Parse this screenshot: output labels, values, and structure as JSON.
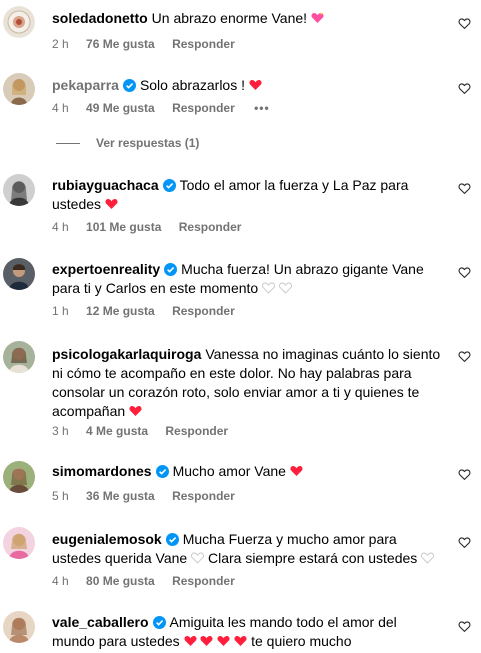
{
  "comments": [
    {
      "username": "soledadonetto",
      "verified": false,
      "muted_name": false,
      "text": "Un abrazo enorme Vane!",
      "emojis": "sparkling-heart",
      "time": "2 h",
      "likes": "76 Me gusta",
      "reply": "Responder",
      "more": ""
    },
    {
      "username": "pekaparra",
      "verified": true,
      "muted_name": true,
      "text": "Solo abrazarlos !",
      "emojis": "red-heart",
      "time": "4 h",
      "likes": "49 Me gusta",
      "reply": "Responder",
      "more": "•••"
    },
    {
      "username": "rubiayguachaca",
      "verified": true,
      "muted_name": false,
      "text": "Todo el amor la fuerza y La Paz para ustedes",
      "emojis": "red-heart",
      "time": "4 h",
      "likes": "101 Me gusta",
      "reply": "Responder",
      "more": ""
    },
    {
      "username": "expertoenreality",
      "verified": true,
      "muted_name": false,
      "text": "Mucha fuerza! Un abrazo gigante Vane para ti y Carlos en este momento",
      "emojis": "white-heart x2",
      "time": "1 h",
      "likes": "12 Me gusta",
      "reply": "Responder",
      "more": ""
    },
    {
      "username": "psicologakarlaquiroga",
      "verified": false,
      "muted_name": false,
      "text": "Vanessa no imaginas cuánto lo siento ni cómo te acompaño en este dolor. No hay palabras para consolar un corazón roto, solo enviar amor a ti y quienes te acompañan",
      "emojis": "red-heart",
      "time": "3 h",
      "likes": "4 Me gusta",
      "reply": "Responder",
      "more": ""
    },
    {
      "username": "simomardones",
      "verified": true,
      "muted_name": false,
      "text": "Mucho amor Vane",
      "emojis": "red-heart",
      "time": "5 h",
      "likes": "36 Me gusta",
      "reply": "Responder",
      "more": ""
    },
    {
      "username": "eugenialemosok",
      "verified": true,
      "muted_name": false,
      "text": "Mucha Fuerza y mucho amor para ustedes querida Vane",
      "text2": "Clara siempre estará con ustedes",
      "emojis": "white-heart",
      "time": "4 h",
      "likes": "80 Me gusta",
      "reply": "Responder",
      "more": ""
    },
    {
      "username": "vale_caballero",
      "verified": true,
      "muted_name": false,
      "text": "Amiguita les mando todo el amor del mundo para ustedes",
      "text_tail": "te quiero mucho",
      "emojis": "red-heart x4",
      "time": "",
      "likes": "",
      "reply": "",
      "more": ""
    }
  ],
  "view_replies": "Ver respuestas (1)",
  "colors": {
    "muted": "#737373",
    "verified": "#0095f6",
    "heart_red": "#ff1f3d",
    "sparkle_pink": "#ff4fa0"
  }
}
